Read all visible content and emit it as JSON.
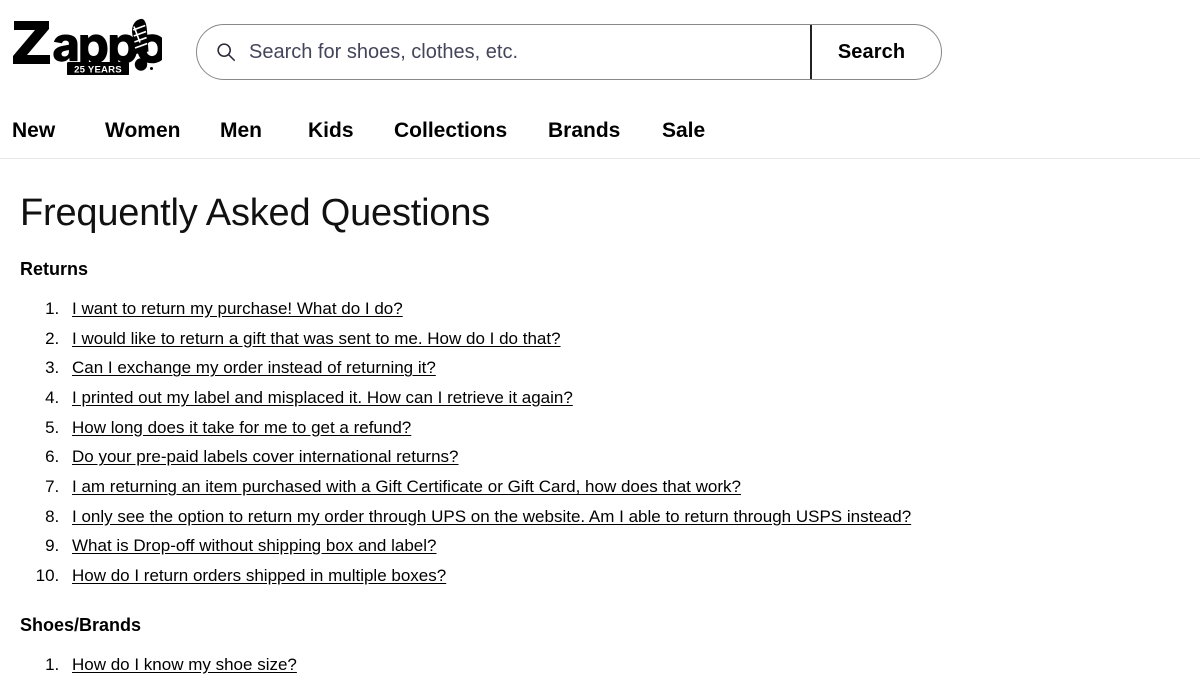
{
  "header": {
    "logo": {
      "name": "Zappos",
      "badge_text": "25 YEARS",
      "trademark": "®"
    },
    "search": {
      "placeholder": "Search for shoes, clothes, etc.",
      "value": "",
      "button_label": "Search",
      "icon": "search-icon"
    },
    "nav": {
      "items": [
        {
          "label": "New",
          "key": "new"
        },
        {
          "label": "Women",
          "key": "women"
        },
        {
          "label": "Men",
          "key": "men"
        },
        {
          "label": "Kids",
          "key": "kids"
        },
        {
          "label": "Collections",
          "key": "collections"
        },
        {
          "label": "Brands",
          "key": "brands"
        },
        {
          "label": "Sale",
          "key": "sale"
        }
      ]
    }
  },
  "main": {
    "page_title": "Frequently Asked Questions",
    "sections": [
      {
        "heading": "Returns",
        "items": [
          "I want to return my purchase! What do I do?",
          "I would like to return a gift that was sent to me. How do I do that?",
          "Can I exchange my order instead of returning it?",
          "I printed out my label and misplaced it. How can I retrieve it again?",
          "How long does it take for me to get a refund?",
          "Do your pre-paid labels cover international returns?",
          "I am returning an item purchased with a Gift Certificate or Gift Card, how does that work?",
          "I only see the option to return my order through UPS on the website. Am I able to return through USPS instead?",
          "What is Drop-off without shipping box and label?",
          "How do I return orders shipped in multiple boxes?"
        ]
      },
      {
        "heading": "Shoes/Brands",
        "items": [
          "How do I know my shoe size?"
        ]
      }
    ]
  },
  "colors": {
    "text": "#000000",
    "page_background": "#ffffff",
    "header_divider": "#e8e8e8",
    "search_border": "#888888",
    "placeholder": "#44455a"
  }
}
